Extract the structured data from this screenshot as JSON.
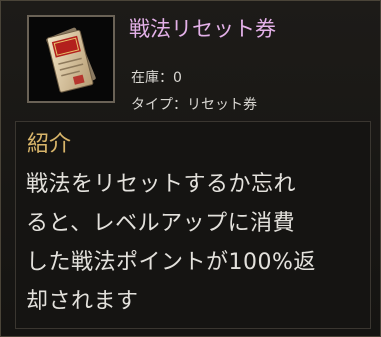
{
  "item": {
    "name": "戦法リセット券",
    "icon": "reset-ticket-icon",
    "stock_label": "在庫",
    "stock_sep": "：",
    "stock_value": "0",
    "type_label": "タイプ",
    "type_sep": "：",
    "type_value": "リセット券"
  },
  "description": {
    "heading": "紹介",
    "lines": [
      "戦法をリセットするか忘れ",
      "ると、レベルアップに消費",
      "した戦法ポイントが100%返",
      "却されます"
    ]
  },
  "colors": {
    "title": "#e3b0e8",
    "heading": "#d8b56a",
    "text": "#e3e1dc"
  }
}
